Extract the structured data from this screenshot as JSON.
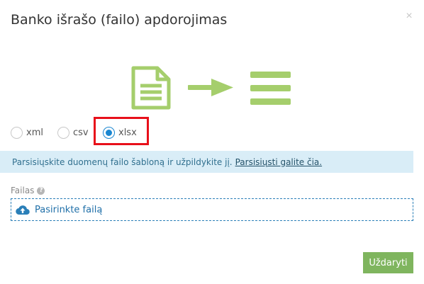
{
  "dialog": {
    "title": "Banko išrašo (failo) apdorojimas",
    "close_symbol": "×"
  },
  "illustration": {
    "icons": [
      "document-icon",
      "arrow-right-icon",
      "list-icon"
    ],
    "color": "#a5ce6c"
  },
  "format_options": [
    {
      "label": "xml",
      "checked": false
    },
    {
      "label": "csv",
      "checked": false
    },
    {
      "label": "xlsx",
      "checked": true
    }
  ],
  "info": {
    "text": "Parsisiųskite duomenų failo šabloną ir užpildykite jį.",
    "link": "Parsisiųsti galite čia."
  },
  "file_field": {
    "label": "Failas",
    "help_symbol": "?",
    "upload_label": "Pasirinkte failą"
  },
  "footer": {
    "close_label": "Uždaryti"
  },
  "colors": {
    "accent_green": "#7fb55e",
    "info_bg": "#d9edf7",
    "radio_blue": "#1a86d0",
    "highlight_red": "#e8101a"
  }
}
